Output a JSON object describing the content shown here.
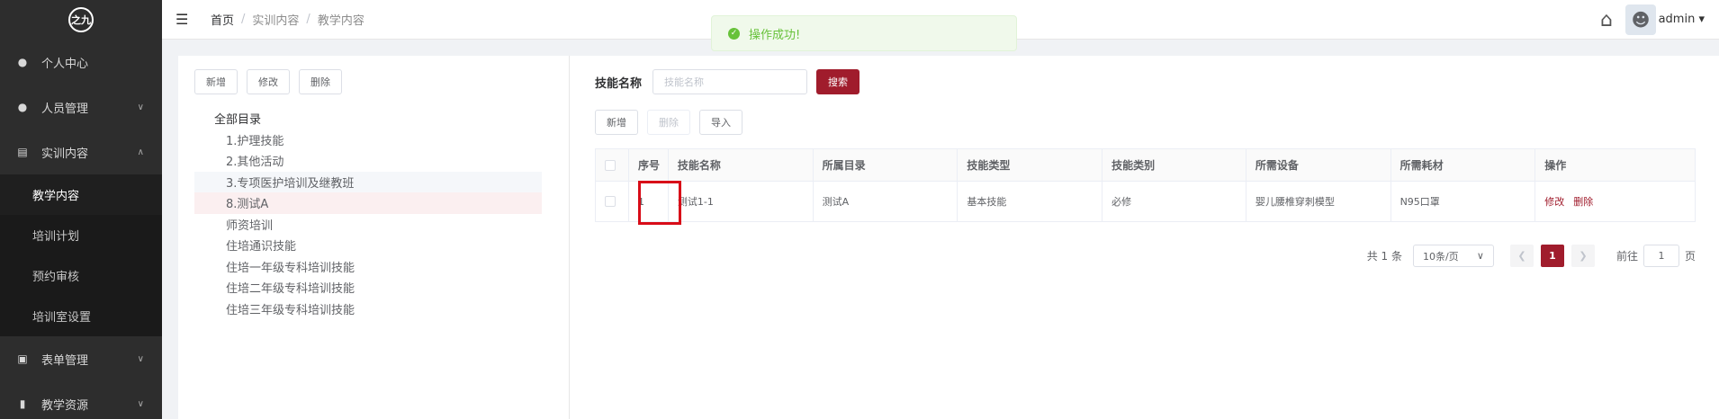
{
  "sidebar": {
    "logo": "之九",
    "items": [
      {
        "label": "个人中心",
        "icon": "user-icon"
      },
      {
        "label": "人员管理",
        "icon": "users-icon"
      },
      {
        "label": "实训内容",
        "icon": "book-icon"
      },
      {
        "label": "表单管理",
        "icon": "form-icon"
      },
      {
        "label": "教学资源",
        "icon": "resource-icon"
      }
    ],
    "submenu": [
      "教学内容",
      "培训计划",
      "预约审核",
      "培训室设置"
    ]
  },
  "header": {
    "breadcrumb": [
      "首页",
      "实训内容",
      "教学内容"
    ],
    "user": "admin"
  },
  "toast": {
    "message": "操作成功!"
  },
  "left": {
    "buttons": [
      "新增",
      "修改",
      "删除"
    ],
    "tree_root": "全部目录",
    "tree_children": [
      "1.护理技能",
      "2.其他活动",
      "3.专项医护培训及继教班",
      "8.测试A",
      "师资培训",
      "住培通识技能",
      "住培一年级专科培训技能",
      "住培二年级专科培训技能",
      "住培三年级专科培训技能"
    ]
  },
  "search": {
    "label": "技能名称",
    "placeholder": "技能名称",
    "button": "搜索"
  },
  "actions": [
    "新增",
    "删除",
    "导入"
  ],
  "table": {
    "columns": [
      "序号",
      "技能名称",
      "所属目录",
      "技能类型",
      "技能类别",
      "所需设备",
      "所需耗材",
      "操作"
    ],
    "rows": [
      {
        "index": "1",
        "name": "测试1-1",
        "directory": "测试A",
        "type": "基本技能",
        "category": "必修",
        "equipment": "婴儿腰椎穿刺模型",
        "consumables": "N95口罩",
        "edit": "修改",
        "delete": "删除"
      }
    ]
  },
  "pagination": {
    "total": "共 1 条",
    "page_size": "10条/页",
    "current": "1",
    "goto_label": "前往",
    "goto_value": "1",
    "page_suffix": "页"
  },
  "colors": {
    "accent": "#a01c2c",
    "sidebar": "#2d2d2d",
    "success": "#67c23a",
    "highlight": "#d80c18"
  }
}
